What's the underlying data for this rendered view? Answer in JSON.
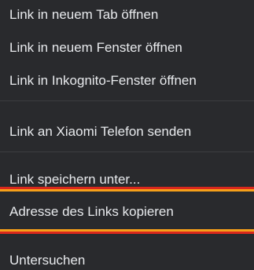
{
  "context_menu": {
    "items": [
      {
        "label": "Link in neuem Tab öffnen"
      },
      {
        "label": "Link in neuem Fenster öffnen"
      },
      {
        "label": "Link in Inkognito-Fenster öffnen"
      },
      {
        "label": "Link an Xiaomi Telefon senden"
      },
      {
        "label": "Link speichern unter..."
      },
      {
        "label": "Adresse des Links kopieren"
      },
      {
        "label": "Untersuchen"
      }
    ]
  },
  "colors": {
    "background": "#292a2d",
    "text": "#e8eaed",
    "divider": "#3c3d40",
    "highlight_red": "#d9281c",
    "highlight_orange": "#f5a01a"
  }
}
